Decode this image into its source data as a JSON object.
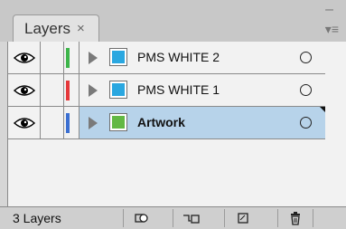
{
  "tab": {
    "title": "Layers",
    "close_glyph": "×"
  },
  "controls": {
    "collapse_glyph": "–",
    "menu_glyph": "▾≡"
  },
  "layers": [
    {
      "name": "PMS WHITE 2",
      "color": "#3db54a",
      "selected": false,
      "bold": false,
      "thumb": "blue"
    },
    {
      "name": "PMS WHITE 1",
      "color": "#e5383b",
      "selected": false,
      "bold": false,
      "thumb": "blue"
    },
    {
      "name": "Artwork",
      "color": "#3b6fd1",
      "selected": true,
      "bold": true,
      "thumb": "green"
    }
  ],
  "footer": {
    "count": "3 Layers"
  }
}
